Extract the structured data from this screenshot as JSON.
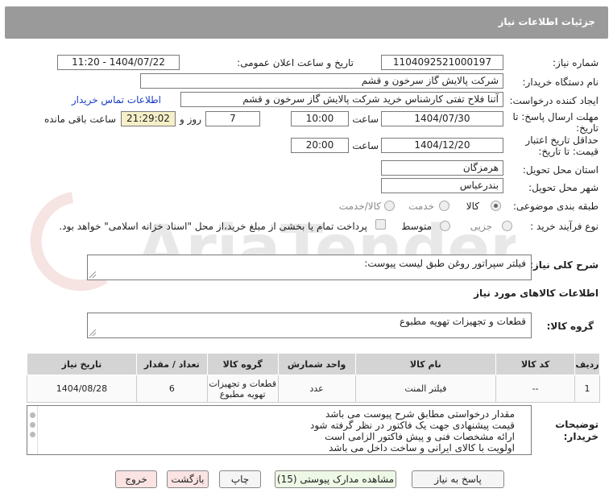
{
  "header": {
    "title": "جزئیات اطلاعات نیاز"
  },
  "form": {
    "need_number_label": "شماره نیاز:",
    "need_number": "1104092521000197",
    "announce_label": "تاریخ و ساعت اعلان عمومی:",
    "announce_value": "1404/07/22 - 11:20",
    "buyer_org_label": "نام دستگاه خریدار:",
    "buyer_org": "شرکت پالایش گاز سرخون و قشم",
    "requester_label": "ایجاد کننده درخواست:",
    "requester": "آتنا فلاح تفتی کارشناس خرید شرکت پالایش گاز سرخون و قشم",
    "contact_link": "اطلاعات تماس خریدار",
    "deadline_label_1": "مهلت ارسال پاسخ: تا",
    "deadline_label_2": "تاریخ:",
    "deadline_date": "1404/07/30",
    "time_label": "ساعت",
    "deadline_time": "10:00",
    "days": "7",
    "days_label": "روز و",
    "remaining": "21:29:02",
    "remaining_label": "ساعت باقی مانده",
    "validity_label_1": "حداقل تاریخ اعتبار",
    "validity_label_2": "قیمت: تا تاریخ:",
    "validity_date": "1404/12/20",
    "validity_time": "20:00",
    "province_label": "استان محل تحویل:",
    "province": "هرمزگان",
    "city_label": "شهر محل تحویل:",
    "city": "بندرعباس",
    "category_label": "طبقه بندی موضوعی:",
    "category_options": [
      "کالا",
      "خدمت",
      "کالا/خدمت"
    ],
    "process_label": "نوع فرآیند خرید :",
    "process_options": [
      "جزیی",
      "متوسط"
    ],
    "payment_note": "پرداخت تمام یا بخشی از مبلغ خرید،از محل \"اسناد خزانه اسلامی\" خواهد بود."
  },
  "description": {
    "label": "شرح کلی نیاز:",
    "text": "فیلتر سپراتور روغن طبق لیست پیوست:"
  },
  "goods": {
    "section_title": "اطلاعات کالاهای مورد نیاز",
    "group_label": "گروه کالا:",
    "group_value": "قطعات و تجهیزات تهویه مطبوع"
  },
  "table": {
    "headers": [
      "ردیف",
      "کد کالا",
      "نام کالا",
      "واحد شمارش",
      "گروه کالا",
      "تعداد / مقدار",
      "تاریخ نیاز"
    ],
    "rows": [
      [
        "1",
        "--",
        "فیلتر المنت",
        "عدد",
        "قطعات و تجهیزات تهویه مطبوع",
        "6",
        "1404/08/28"
      ]
    ]
  },
  "notes": {
    "label_1": "توضیحات",
    "label_2": "خریدار:",
    "lines": [
      "مقدار درخواستی مطابق شرح پیوست می باشد",
      "قیمت پیشنهادی جهت یک فاکتور در نظر گرفته شود",
      "ارائه مشخصات فنی و پیش فاکتور الزامی است",
      "اولویت با کالای ایرانی و ساخت داخل می باشد"
    ]
  },
  "buttons": {
    "reply": "پاسخ به نیاز",
    "attachments": "مشاهده مدارک پیوستی (15)",
    "print": "چاپ",
    "back": "بازگشت",
    "exit": "خروج"
  },
  "watermark": {
    "text": "AriaTender.net"
  }
}
